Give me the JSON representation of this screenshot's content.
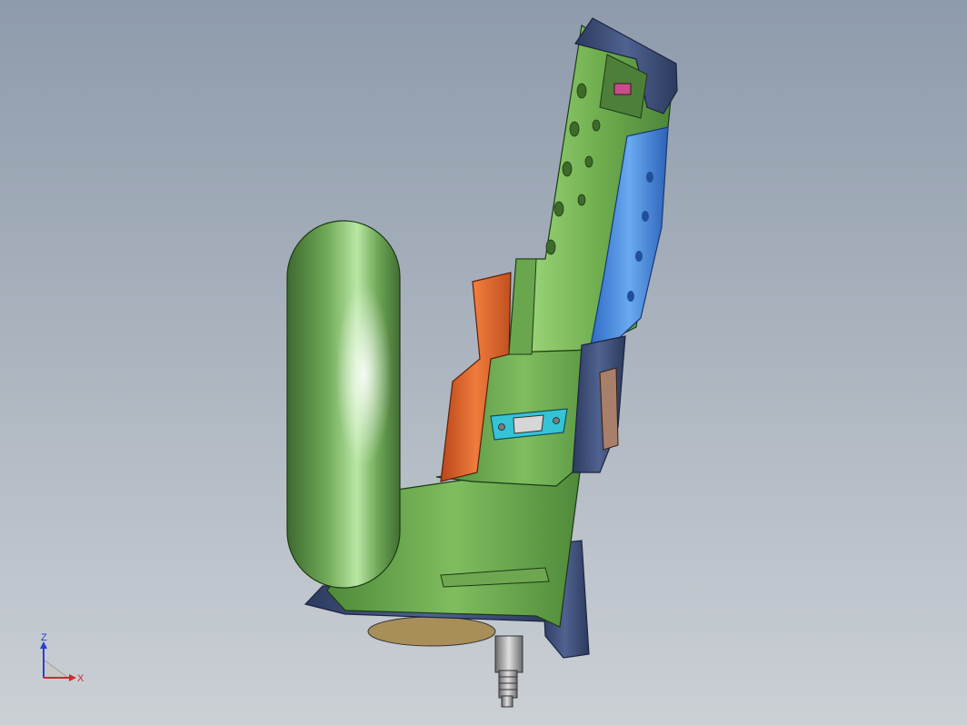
{
  "viewport": {
    "background_top": "#8e9bac",
    "background_bottom": "#cbd0d5"
  },
  "model": {
    "colors": {
      "body_green": "#5f9a45",
      "body_green_light": "#8fcf6c",
      "trigger_orange": "#e2662c",
      "grip_blue": "#3f82d8",
      "frame_navy": "#3a4a72",
      "connector_cyan": "#35c3d6",
      "cylinder_green": "#5c8f48"
    }
  },
  "triad": {
    "z_label": "Z",
    "x_label": "X",
    "z_color": "#2a3fd0",
    "x_color": "#d02a2a"
  }
}
